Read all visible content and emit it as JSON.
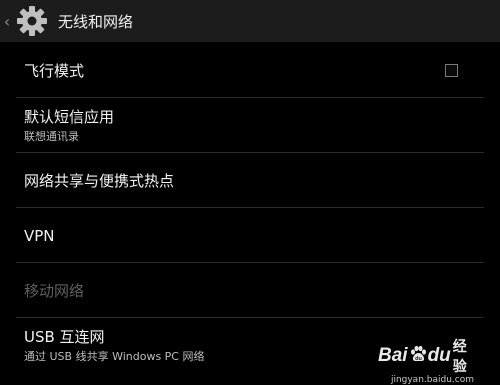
{
  "action_bar": {
    "title": "无线和网络",
    "up_glyph": "‹",
    "icon": "settings-gear-icon"
  },
  "items": [
    {
      "title": "飞行模式",
      "subtitle": "",
      "checkbox": false,
      "enabled": true
    },
    {
      "title": "默认短信应用",
      "subtitle": "联想通讯录",
      "enabled": true
    },
    {
      "title": "网络共享与便携式热点",
      "subtitle": "",
      "enabled": true
    },
    {
      "title": "VPN",
      "subtitle": "",
      "enabled": true
    },
    {
      "title": "移动网络",
      "subtitle": "",
      "enabled": false
    },
    {
      "title": "USB 互连网",
      "subtitle": "通过 USB 线共享 Windows PC 网络",
      "enabled": true
    }
  ],
  "watermark": {
    "brand_latin_1": "Bai",
    "brand_latin_2": "du",
    "brand_cn": "经验",
    "url": "jingyan.baidu.com"
  },
  "colors": {
    "background": "#000000",
    "action_bar": "#1c1c1c",
    "primary_text": "#f2f2f2",
    "secondary_text": "#bdbdbd",
    "disabled_text": "#5f5f5f",
    "divider": "#2c2c2c"
  }
}
